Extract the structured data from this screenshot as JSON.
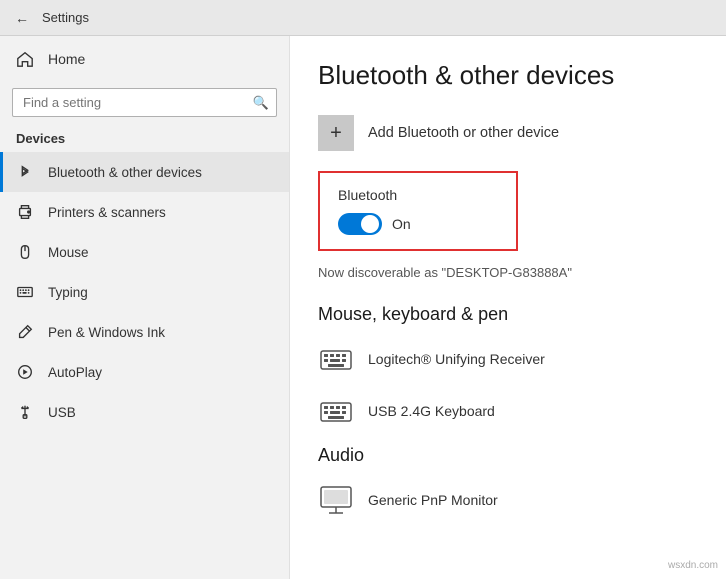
{
  "titlebar": {
    "title": "Settings",
    "back_label": "←"
  },
  "sidebar": {
    "home_label": "Home",
    "search_placeholder": "Find a setting",
    "section_label": "Devices",
    "items": [
      {
        "id": "bluetooth",
        "label": "Bluetooth & other devices",
        "active": true
      },
      {
        "id": "printers",
        "label": "Printers & scanners",
        "active": false
      },
      {
        "id": "mouse",
        "label": "Mouse",
        "active": false
      },
      {
        "id": "typing",
        "label": "Typing",
        "active": false
      },
      {
        "id": "pen",
        "label": "Pen & Windows Ink",
        "active": false
      },
      {
        "id": "autoplay",
        "label": "AutoPlay",
        "active": false
      },
      {
        "id": "usb",
        "label": "USB",
        "active": false
      }
    ]
  },
  "content": {
    "page_title": "Bluetooth & other devices",
    "add_device_label": "Add Bluetooth or other device",
    "bluetooth_section_label": "Bluetooth",
    "toggle_state": "On",
    "discoverable_text": "Now discoverable as \"DESKTOP-G83888A\"",
    "mouse_section": {
      "title": "Mouse, keyboard & pen",
      "devices": [
        {
          "name": "Logitech® Unifying Receiver"
        },
        {
          "name": "USB 2.4G Keyboard"
        }
      ]
    },
    "audio_section": {
      "title": "Audio",
      "devices": [
        {
          "name": "Generic PnP Monitor"
        }
      ]
    }
  },
  "watermark": "wsxdn.com"
}
